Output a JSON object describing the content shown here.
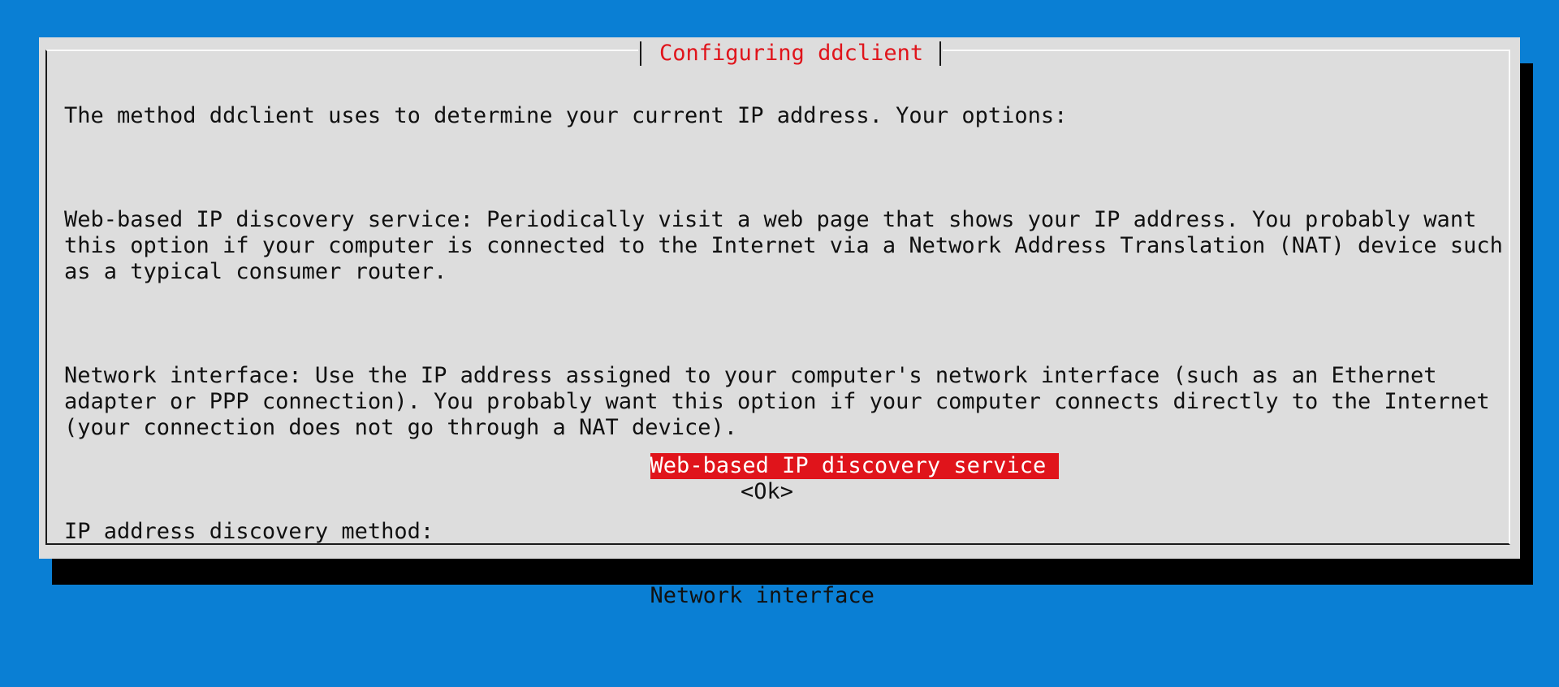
{
  "dialog": {
    "title": "Configuring ddclient",
    "intro": "The method ddclient uses to determine your current IP address. Your options:",
    "web_paragraph": "Web-based IP discovery service: Periodically visit a web page that shows your IP address. You probably want\nthis option if your computer is connected to the Internet via a Network Address Translation (NAT) device such\nas a typical consumer router.",
    "network_paragraph": "Network interface: Use the IP address assigned to your computer's network interface (such as an Ethernet\nadapter or PPP connection). You probably want this option if your computer connects directly to the Internet\n(your connection does not go through a NAT device).",
    "prompt": "IP address discovery method:",
    "options": [
      {
        "label": "Web-based IP discovery service",
        "selected": true
      },
      {
        "label": "Network interface",
        "selected": false
      }
    ],
    "ok_label": "<Ok>"
  },
  "colors": {
    "background": "#0a7fd4",
    "dialog": "#dddddd",
    "accent": "#e0141b",
    "text": "#111111"
  }
}
